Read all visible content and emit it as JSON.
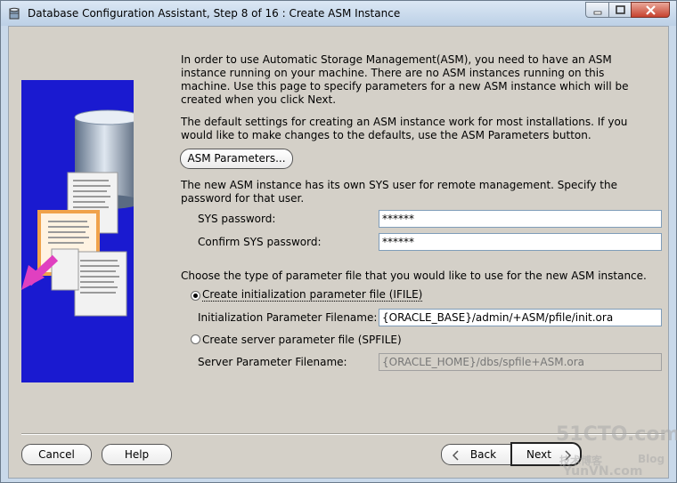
{
  "window": {
    "title": "Database Configuration Assistant, Step 8 of 16 : Create ASM Instance"
  },
  "intro": {
    "paragraph1": "In order to use Automatic Storage Management(ASM), you need to have an ASM instance running on your machine. There are no ASM instances running on this machine. Use this page to specify parameters for a new ASM instance which will be created when you click Next.",
    "paragraph2": "The default settings for creating an ASM instance work for most installations. If you would like to make changes to the defaults, use the ASM Parameters button.",
    "asm_parameters_button": "ASM Parameters...",
    "paragraph3": "The new ASM instance has its own SYS user for remote management. Specify the password for that user."
  },
  "credentials": {
    "sys_password_label": "SYS password:",
    "sys_password_value": "******",
    "confirm_password_label": "Confirm SYS password:",
    "confirm_password_value": "******"
  },
  "parameter_file": {
    "prompt": "Choose the type of parameter file that you would like to use for the new ASM instance.",
    "ifile_option": "Create initialization parameter file (IFILE)",
    "ifile_selected": true,
    "ifile_filename_label": "Initialization Parameter Filename:",
    "ifile_filename_value": "{ORACLE_BASE}/admin/+ASM/pfile/init.ora",
    "spfile_option": "Create server parameter file (SPFILE)",
    "spfile_selected": false,
    "spfile_filename_label": "Server Parameter Filename:",
    "spfile_filename_value": "{ORACLE_HOME}/dbs/spfile+ASM.ora"
  },
  "footer": {
    "cancel_label": "Cancel",
    "help_label": "Help",
    "back_label": "Back",
    "next_label": "Next"
  },
  "watermark": {
    "site": "51CTO.com",
    "cn_text": "技术博客",
    "blog": "Blog",
    "sub": "YunVN.com"
  },
  "colors": {
    "graphic_background": "#1a1ad0",
    "arrow": "#e040c0",
    "title_bar": "#c9d9ea"
  }
}
